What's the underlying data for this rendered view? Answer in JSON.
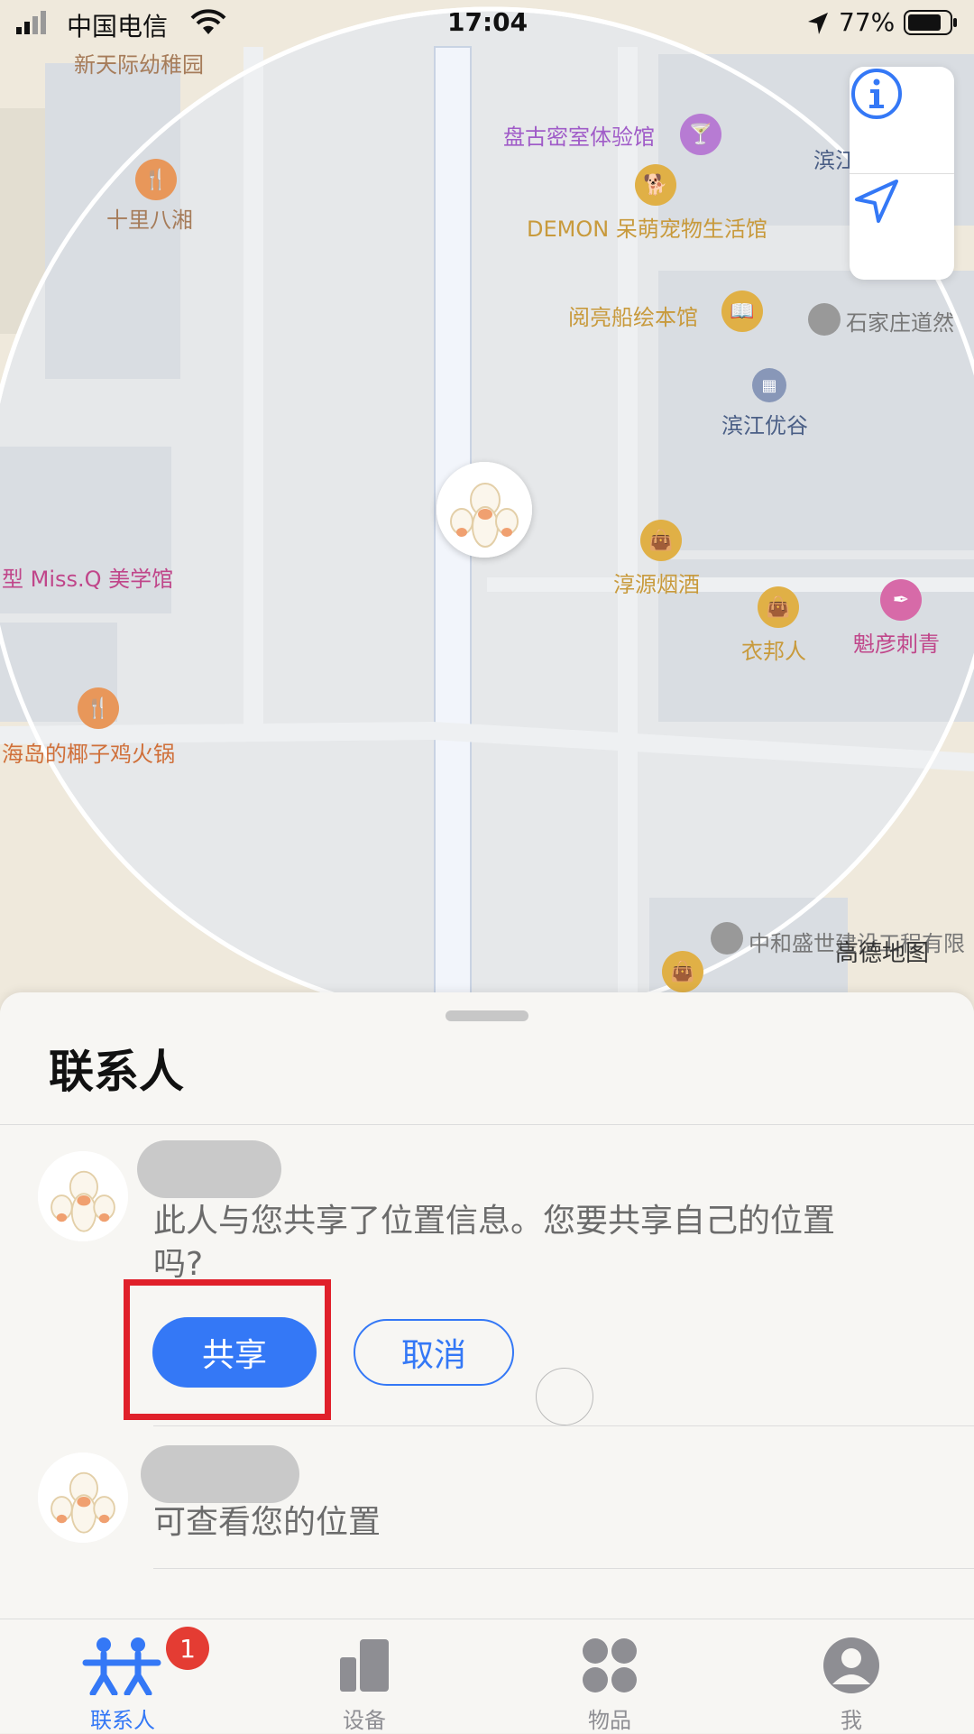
{
  "status_bar": {
    "carrier": "中国电信",
    "time": "17:04",
    "battery": "77%"
  },
  "map": {
    "pois": [
      {
        "name": "新天际幼稚园",
        "color": "#a67c5a"
      },
      {
        "name": "十里八湘",
        "color": "#a67c5a",
        "icon": "fork-knife-icon",
        "icon_color": "#e8975a"
      },
      {
        "name": "盘古密室体验馆",
        "color": "#a05cc8",
        "icon": "cocktail-icon",
        "icon_color": "#b77bd3"
      },
      {
        "name": "DEMON 呆萌宠物生活馆",
        "color": "#c89a3c",
        "icon": "dog-icon",
        "icon_color": "#e0b046"
      },
      {
        "name": "阅亮船绘本馆",
        "color": "#c89a3c",
        "icon": "book-icon",
        "icon_color": "#e0b046"
      },
      {
        "name": "石家庄道然",
        "color": "#777777",
        "icon": "dot-icon",
        "icon_color": "#999999"
      },
      {
        "name": "滨江优谷",
        "color": "#4b5f86",
        "icon": "building-icon",
        "icon_color": "#8897b8"
      },
      {
        "name": "淳源烟酒",
        "color": "#c89a3c",
        "icon": "bag-icon",
        "icon_color": "#e0b046"
      },
      {
        "name": "衣邦人",
        "color": "#c89a3c",
        "icon": "bag-icon",
        "icon_color": "#e0b046"
      },
      {
        "name": "魁彦刺青",
        "color": "#c0468a",
        "icon": "tattoo-icon",
        "icon_color": "#d76aa8"
      },
      {
        "name": "型 Miss.Q 美学馆",
        "color": "#c0468a"
      },
      {
        "name": "海岛的椰子鸡火锅",
        "color": "#d0703a",
        "icon": "fork-knife-icon",
        "icon_color": "#e8975a"
      },
      {
        "name": "中和盛世建设工程有限",
        "color": "#777777",
        "icon": "dot-icon",
        "icon_color": "#999999"
      },
      {
        "name": "滨江",
        "color": "#4b5f86"
      }
    ],
    "watermark": "高德地图",
    "controls": {
      "info": "info-icon",
      "locate": "location-arrow-icon"
    }
  },
  "sheet": {
    "title": "联系人",
    "contacts": [
      {
        "message": "此人与您共享了位置信息。您要共享自己的位置吗?",
        "share_label": "共享",
        "cancel_label": "取消"
      },
      {
        "message": "可查看您的位置"
      }
    ]
  },
  "tabs": [
    {
      "label": "联系人",
      "icon": "people-icon",
      "active": true,
      "badge": "1"
    },
    {
      "label": "设备",
      "icon": "devices-icon",
      "active": false
    },
    {
      "label": "物品",
      "icon": "items-icon",
      "active": false
    },
    {
      "label": "我",
      "icon": "profile-icon",
      "active": false
    }
  ],
  "colors": {
    "accent": "#3478f6",
    "highlight": "#e0202a",
    "badge": "#e43c33"
  }
}
